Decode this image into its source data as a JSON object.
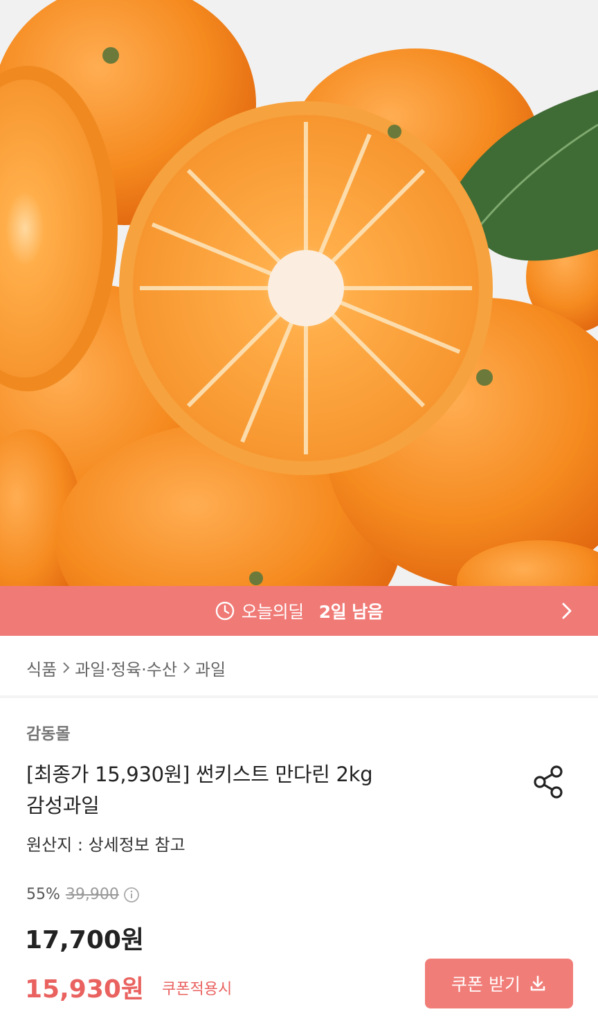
{
  "product_image": {
    "alt": "mandarin oranges"
  },
  "deal_bar": {
    "label": "오늘의딜",
    "remaining": "2일 남음",
    "icon": "clock-icon"
  },
  "breadcrumb": [
    "식품",
    "과일·정육·수산",
    "과일"
  ],
  "seller": "감동몰",
  "title_line1": "[최종가 15,930원] 썬키스트 만다린 2kg",
  "title_line2": "감성과일",
  "origin": "원산지 : 상세정보 참고",
  "discount_percent": "55%",
  "original_price": "39,900",
  "price": "17,700원",
  "coupon_price": "15,930원",
  "coupon_note": "쿠폰적용시",
  "coupon_button": "쿠폰 받기",
  "colors": {
    "accent": "#f07a76",
    "coupon_text": "#e9625f"
  }
}
